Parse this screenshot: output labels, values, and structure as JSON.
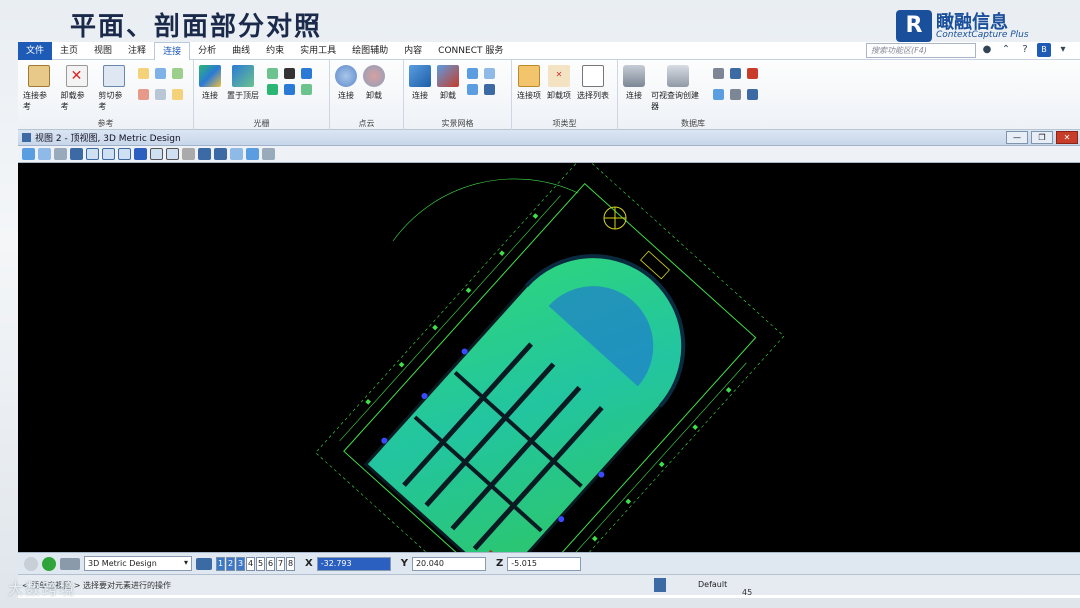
{
  "slide": {
    "title": "平面、剖面部分对照",
    "brand_name": "瞰融信息",
    "brand_sub": "ContextCapture Plus",
    "page_number": "45",
    "watermark": "大数跨境"
  },
  "menu": {
    "items": [
      "文件",
      "主页",
      "视图",
      "注释",
      "连接",
      "分析",
      "曲线",
      "约束",
      "实用工具",
      "绘图辅助",
      "内容",
      "CONNECT 服务"
    ],
    "active": "连接",
    "search_placeholder": "搜索功能区(F4)"
  },
  "ribbon": {
    "groups": [
      {
        "label": "参考",
        "buttons": [
          "连接参考",
          "卸载参考",
          "剪切参考"
        ]
      },
      {
        "label": "光栅",
        "buttons": [
          "连接",
          "置于顶层"
        ]
      },
      {
        "label": "点云",
        "buttons": [
          "连接",
          "卸载"
        ]
      },
      {
        "label": "实景网格",
        "buttons": [
          "连接",
          "卸载"
        ]
      },
      {
        "label": "项类型",
        "buttons": [
          "连接项",
          "卸载项",
          "选择列表"
        ]
      },
      {
        "label": "数据库",
        "buttons": [
          "连接",
          "可视查询创建器"
        ]
      }
    ]
  },
  "view": {
    "title": "视图 2 - 顶视图, 3D Metric Design"
  },
  "status": {
    "model": "3D Metric Design",
    "view_numbers": [
      "1",
      "2",
      "3",
      "4",
      "5",
      "6",
      "7",
      "8"
    ],
    "active_views": [
      "1",
      "2",
      "3"
    ],
    "x_label": "X",
    "x_value": "-32.793",
    "y_label": "Y",
    "y_value": "20.040",
    "z_label": "Z",
    "z_value": "-5.015",
    "prompt": "< 要单击视图 > 选择要对元素进行的操作",
    "level": "Default"
  },
  "colors": {
    "accent": "#1e5bb7",
    "canvas": "#000000",
    "point_cloud": "#2fd67a",
    "dimension": "#3fe04a"
  }
}
